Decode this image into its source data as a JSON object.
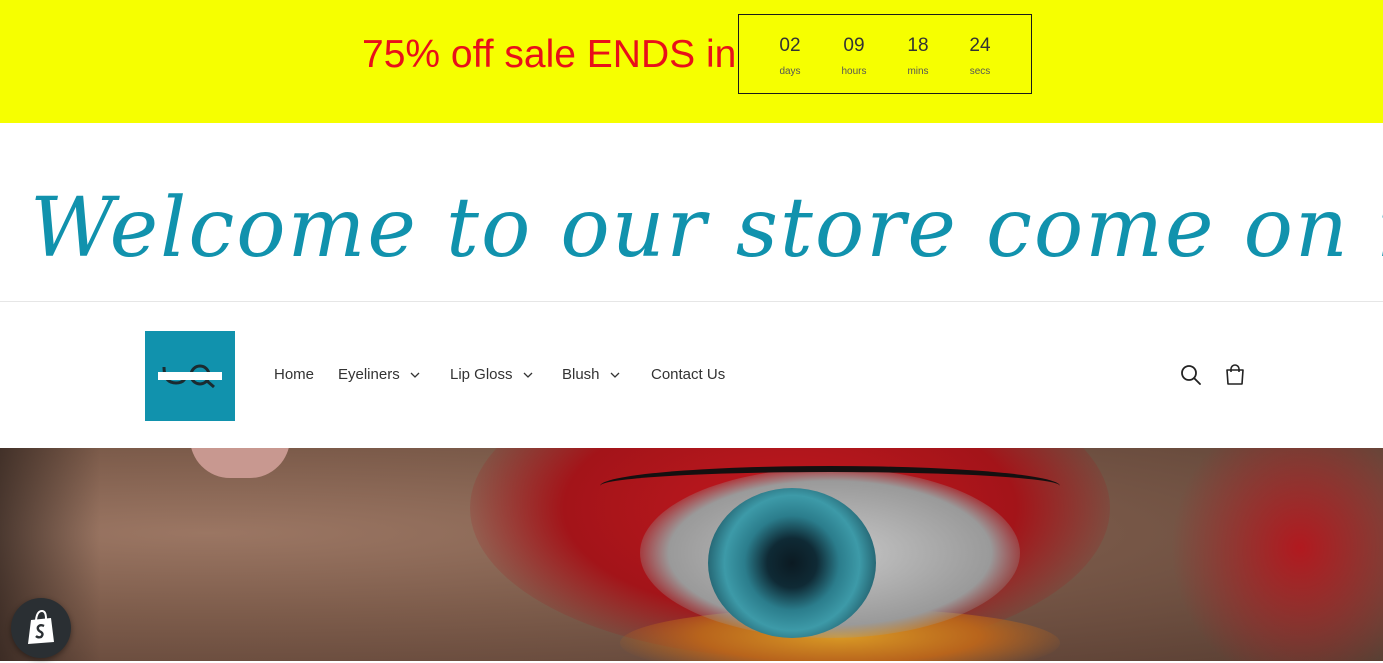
{
  "countdown": {
    "sale_text": "75% off sale ENDS in",
    "units": [
      {
        "value": "02",
        "label": "days"
      },
      {
        "value": "09",
        "label": "hours"
      },
      {
        "value": "18",
        "label": "mins"
      },
      {
        "value": "24",
        "label": "secs"
      }
    ]
  },
  "marquee": {
    "text": "Welcome to our store come on in we are ho"
  },
  "header": {
    "nav": [
      {
        "label": "Home",
        "has_dropdown": false
      },
      {
        "label": "Eyeliners",
        "has_dropdown": true
      },
      {
        "label": "Lip Gloss",
        "has_dropdown": true
      },
      {
        "label": "Blush",
        "has_dropdown": true
      },
      {
        "label": "Contact Us",
        "has_dropdown": false
      }
    ],
    "icons": [
      "search-icon",
      "cart-icon"
    ]
  },
  "colors": {
    "banner_bg": "#f6ff00",
    "sale_text": "#e8101a",
    "accent_teal": "#1192ad"
  }
}
